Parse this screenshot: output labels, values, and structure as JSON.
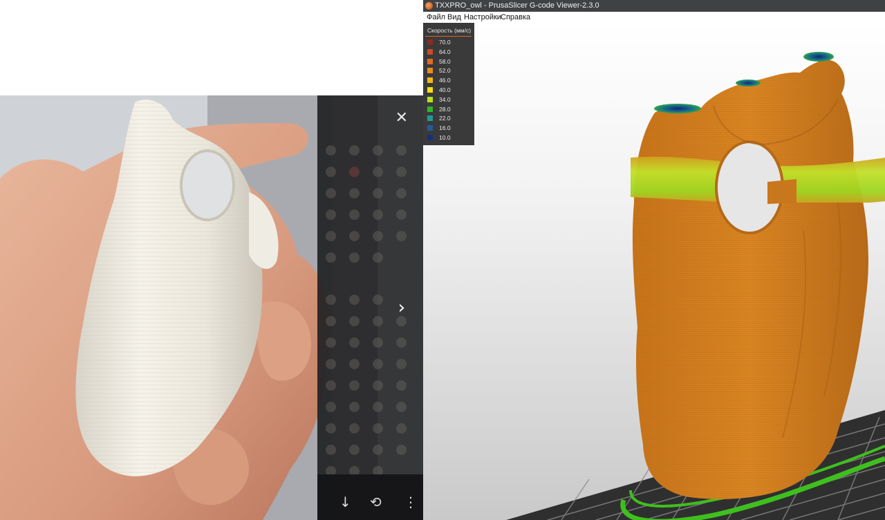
{
  "window": {
    "title": "TXXPRO_owl - PrusaSlicer G-code Viewer-2.3.0"
  },
  "menu": [
    "Файл",
    "Вид",
    "Настройки",
    "Справка"
  ],
  "legend": {
    "title": "Скорость (мм/с)",
    "items": [
      {
        "value": "70.0",
        "color": "#8c2a1e"
      },
      {
        "value": "64.0",
        "color": "#c84a2d"
      },
      {
        "value": "58.0",
        "color": "#dc6a25"
      },
      {
        "value": "52.0",
        "color": "#ea8a1e"
      },
      {
        "value": "46.0",
        "color": "#f2b616"
      },
      {
        "value": "40.0",
        "color": "#f4e00f"
      },
      {
        "value": "34.0",
        "color": "#b7e023"
      },
      {
        "value": "28.0",
        "color": "#2eb52e"
      },
      {
        "value": "22.0",
        "color": "#1e9a96"
      },
      {
        "value": "16.0",
        "color": "#1f5c98"
      },
      {
        "value": "10.0",
        "color": "#17307a"
      }
    ]
  },
  "phone_overlay": {
    "close_icon": "close-icon",
    "next_icon": "chevron-right-icon",
    "bottom_icons": [
      "download-icon",
      "rotate-icon",
      "more-vertical-icon"
    ]
  },
  "colors": {
    "model_orange": "#cf7a1a",
    "bed_green": "#3fbf1e",
    "bed_grid": "#3b3b3b"
  }
}
